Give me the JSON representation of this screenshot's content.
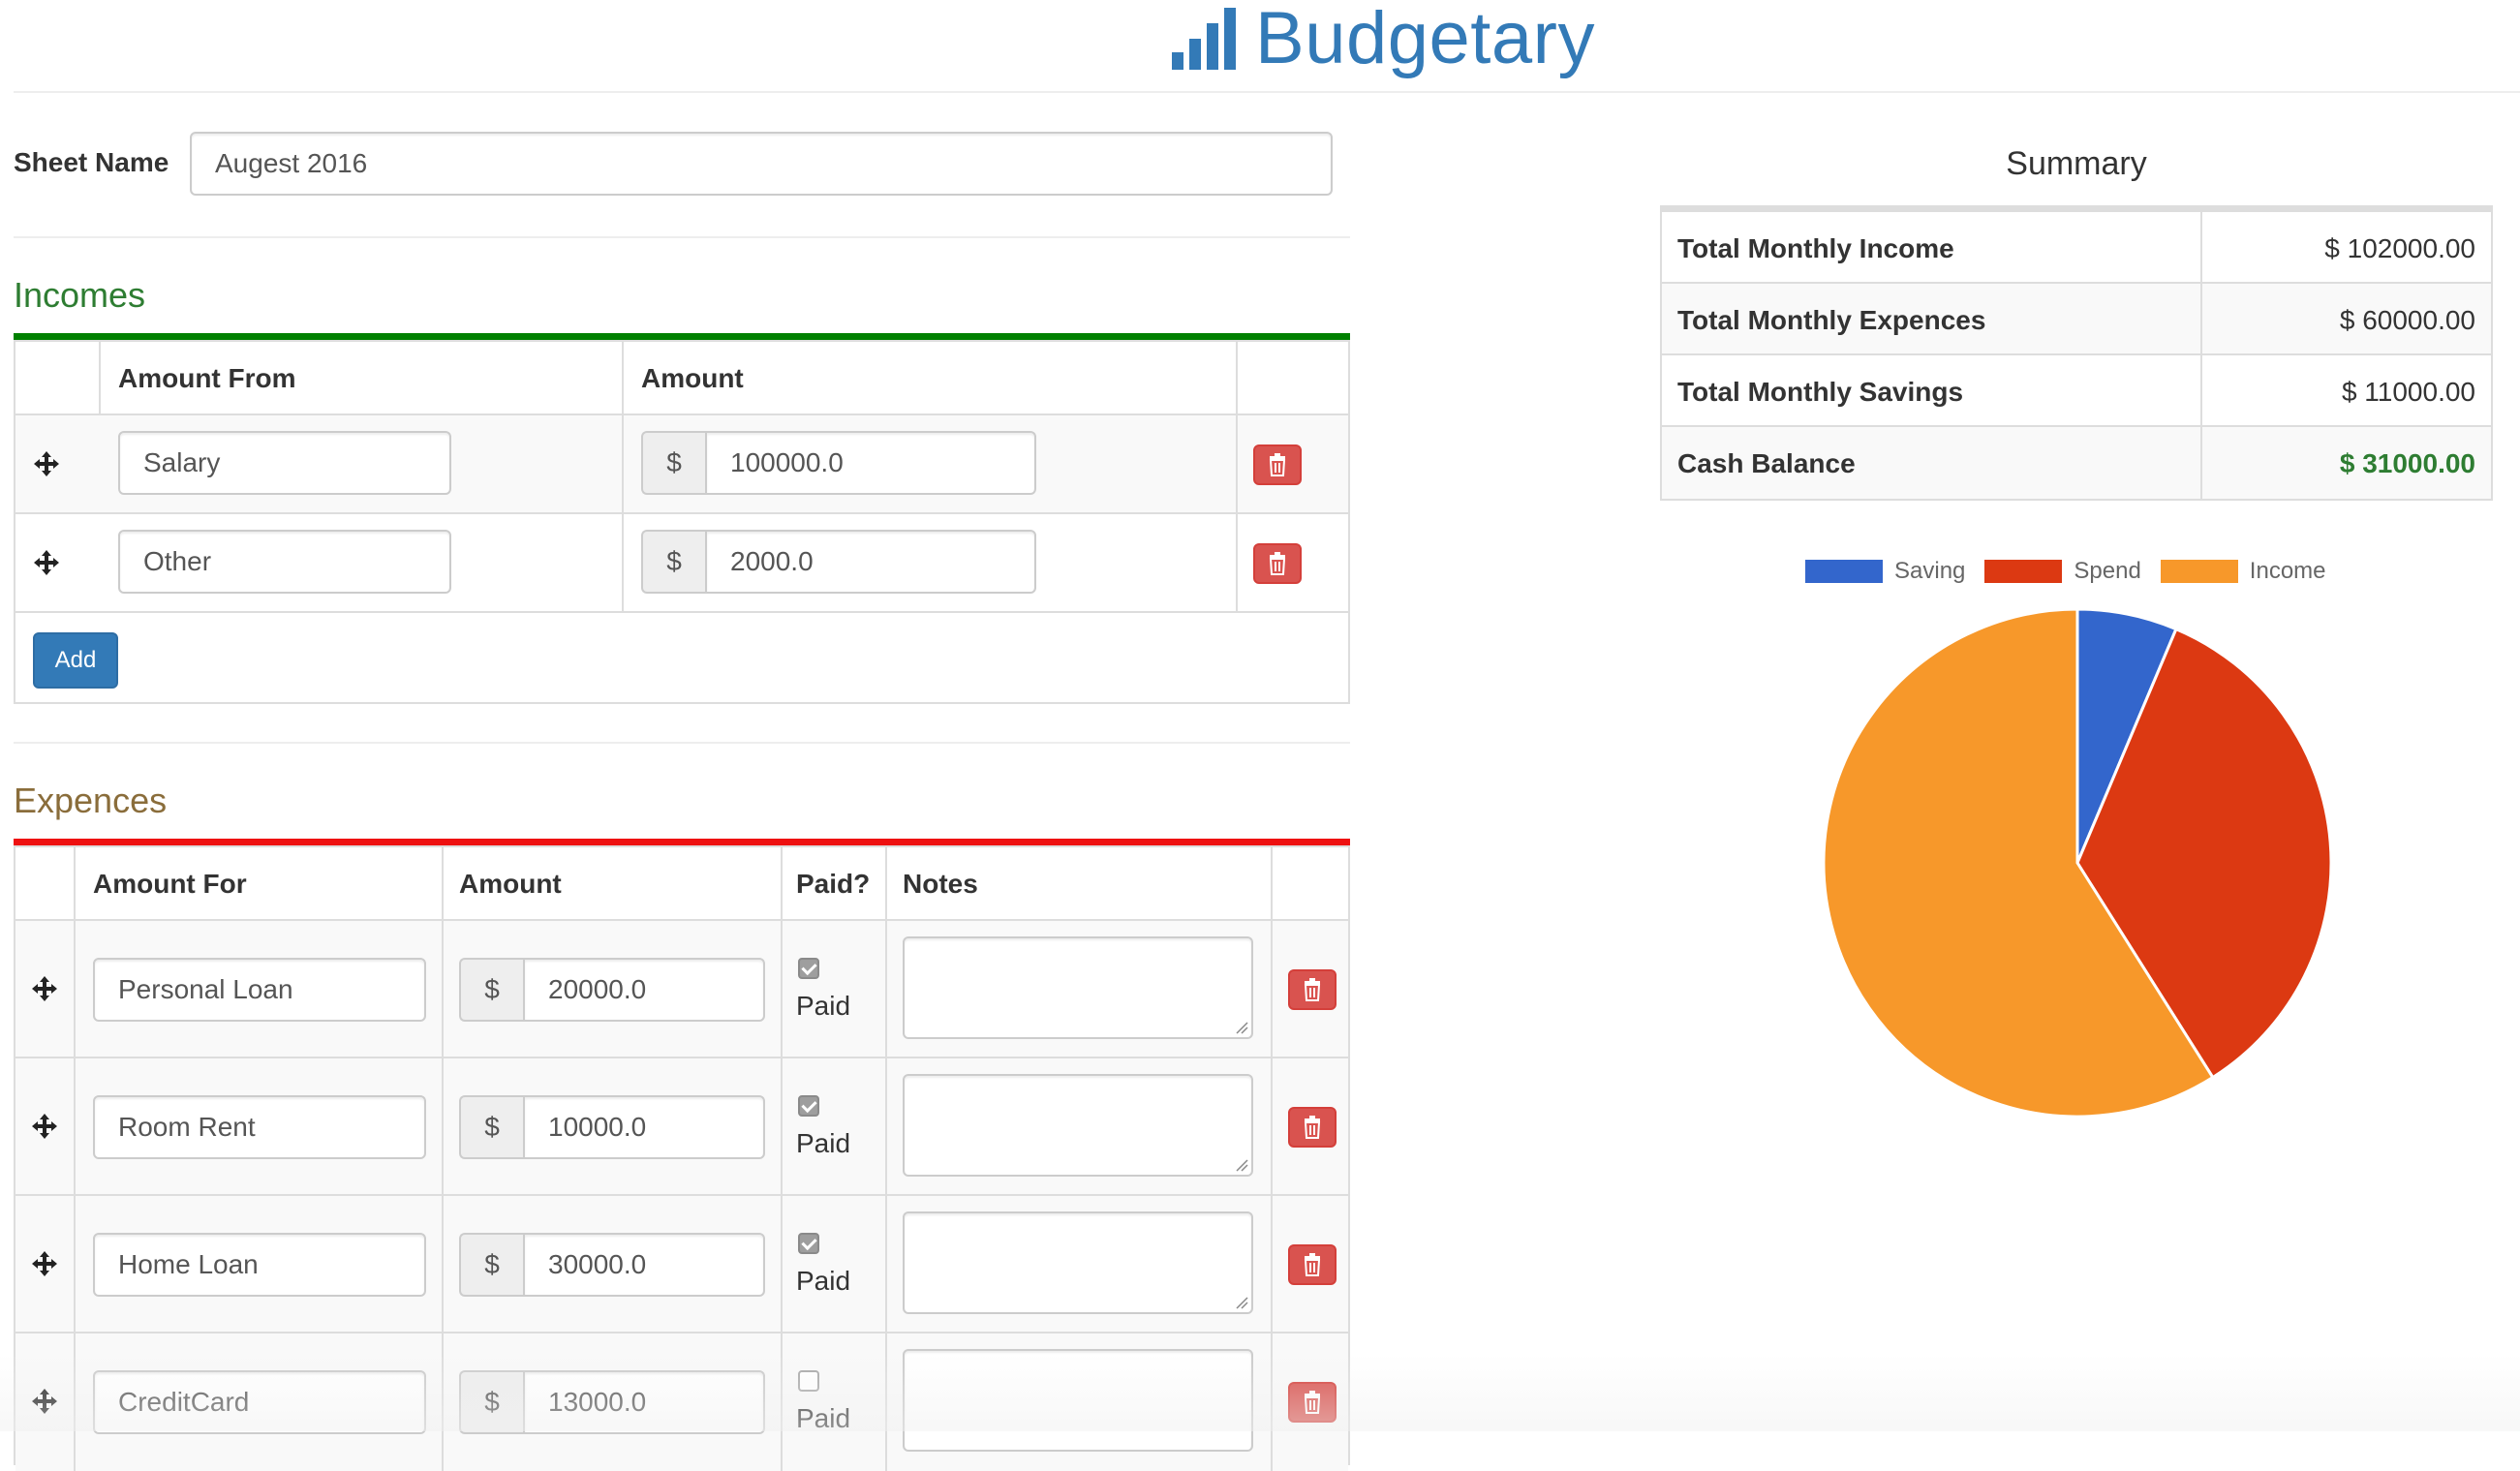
{
  "app": {
    "title": "Budgetary",
    "brand_color": "#337ab7"
  },
  "sheet": {
    "label": "Sheet Name",
    "name": "Augest 2016"
  },
  "incomes": {
    "title": "Incomes",
    "accent_color": "#008000",
    "headers": {
      "source": "Amount From",
      "amount": "Amount"
    },
    "currency": "$",
    "rows": [
      {
        "source": "Salary",
        "amount": "100000.0"
      },
      {
        "source": "Other",
        "amount": "2000.0"
      }
    ],
    "add_label": "Add"
  },
  "expences": {
    "title": "Expences",
    "accent_color": "#ee1111",
    "headers": {
      "for": "Amount For",
      "amount": "Amount",
      "paid": "Paid?",
      "notes": "Notes"
    },
    "currency": "$",
    "paid_label": "Paid",
    "rows": [
      {
        "for": "Personal Loan",
        "amount": "20000.0",
        "paid": true,
        "notes": ""
      },
      {
        "for": "Room Rent",
        "amount": "10000.0",
        "paid": true,
        "notes": ""
      },
      {
        "for": "Home Loan",
        "amount": "30000.0",
        "paid": true,
        "notes": ""
      },
      {
        "for": "CreditCard",
        "amount": "13000.0",
        "paid": false,
        "notes": ""
      }
    ]
  },
  "summary": {
    "title": "Summary",
    "rows": [
      {
        "label": "Total Monthly Income",
        "value": "$ 102000.00"
      },
      {
        "label": "Total Monthly Expences",
        "value": "$ 60000.00"
      },
      {
        "label": "Total Monthly Savings",
        "value": "$ 11000.00"
      },
      {
        "label": "Cash Balance",
        "value": "$ 31000.00"
      }
    ],
    "balance_color": "#2e7d32"
  },
  "chart_data": {
    "type": "pie",
    "categories": [
      "Saving",
      "Spend",
      "Income"
    ],
    "values": [
      11000,
      60000,
      102000
    ],
    "colors": [
      "#3366cc",
      "#dc3912",
      "#f7982a"
    ],
    "legend_position": "top"
  }
}
